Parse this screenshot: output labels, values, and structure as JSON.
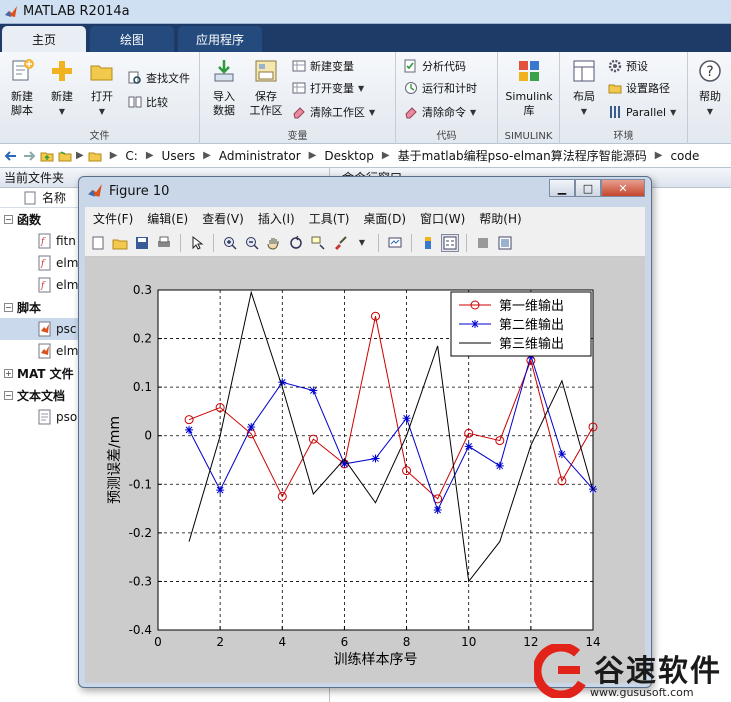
{
  "window": {
    "title": "MATLAB R2014a"
  },
  "tabs": [
    {
      "label": "主页"
    },
    {
      "label": "绘图"
    },
    {
      "label": "应用程序"
    }
  ],
  "ribbon": {
    "file": {
      "label": "文件",
      "new_script": "新建\n脚本",
      "new": "新建",
      "open": "打开",
      "find_files": "查找文件",
      "compare": "比较"
    },
    "variable": {
      "label": "变量",
      "import_data": "导入\n数据",
      "save_workspace": "保存\n工作区",
      "new_variable": "新建变量",
      "open_variable": "打开变量",
      "clear_workspace": "清除工作区"
    },
    "code": {
      "label": "代码",
      "analyze_code": "分析代码",
      "run_and_time": "运行和计时",
      "clear_commands": "清除命令"
    },
    "simulink": {
      "label": "SIMULINK",
      "library": "Simulink\n库"
    },
    "environment": {
      "label": "环境",
      "layout": "布局",
      "preferences": "预设",
      "set_path": "设置路径",
      "parallel": "Parallel"
    },
    "help": {
      "label": "帮助"
    }
  },
  "address": {
    "crumbs": [
      "C:",
      "Users",
      "Administrator",
      "Desktop",
      "基于matlab编程pso-elman算法程序智能源码",
      "code"
    ]
  },
  "current_folder": {
    "header": "当前文件夹",
    "name_column": "名称",
    "tree": [
      {
        "type": "cat",
        "label": "函数",
        "expander": "−"
      },
      {
        "type": "file",
        "label": "fitn",
        "icon": "function-file-icon"
      },
      {
        "type": "file",
        "label": "elm",
        "icon": "function-file-icon"
      },
      {
        "type": "file",
        "label": "elm",
        "icon": "function-file-icon"
      },
      {
        "type": "cat",
        "label": "脚本",
        "expander": "−"
      },
      {
        "type": "file",
        "label": "psc",
        "icon": "script-file-icon",
        "selected": true
      },
      {
        "type": "file",
        "label": "elm",
        "icon": "script-file-icon"
      },
      {
        "type": "cat",
        "label": "MAT 文件",
        "expander": "+"
      },
      {
        "type": "cat",
        "label": "文本文档",
        "expander": "−"
      },
      {
        "type": "file",
        "label": "pso",
        "icon": "text-file-icon"
      }
    ]
  },
  "command_window": {
    "header": "命令行窗口"
  },
  "figure": {
    "title": "Figure 10",
    "menus": [
      "文件(F)",
      "编辑(E)",
      "查看(V)",
      "插入(I)",
      "工具(T)",
      "桌面(D)",
      "窗口(W)",
      "帮助(H)"
    ]
  },
  "chart_data": {
    "type": "line",
    "title": "",
    "xlabel": "训练样本序号",
    "ylabel": "预测误差/mm",
    "xlim": [
      0,
      14
    ],
    "ylim": [
      -0.4,
      0.3
    ],
    "xticks": [
      0,
      2,
      4,
      6,
      8,
      10,
      12,
      14
    ],
    "yticks": [
      -0.4,
      -0.3,
      -0.2,
      -0.1,
      0,
      0.1,
      0.2,
      0.3
    ],
    "grid": true,
    "legend_position": "top-right",
    "x": [
      1,
      2,
      3,
      4,
      5,
      6,
      7,
      8,
      9,
      10,
      11,
      12,
      13,
      14
    ],
    "series": [
      {
        "name": "第一维输出",
        "color": "#cc0000",
        "marker": "circle",
        "values": [
          0.033,
          0.058,
          0.004,
          -0.125,
          -0.007,
          -0.058,
          0.246,
          -0.072,
          -0.13,
          0.005,
          -0.01,
          0.155,
          -0.093,
          0.018
        ]
      },
      {
        "name": "第二维输出",
        "color": "#0000cc",
        "marker": "star",
        "values": [
          0.012,
          -0.112,
          0.018,
          0.11,
          0.093,
          -0.058,
          -0.047,
          0.036,
          -0.153,
          -0.022,
          -0.062,
          0.165,
          -0.038,
          -0.11
        ]
      },
      {
        "name": "第三维输出",
        "color": "#000000",
        "marker": "none",
        "values": [
          -0.218,
          0.0,
          0.295,
          0.1,
          -0.12,
          -0.048,
          -0.138,
          0.0,
          0.185,
          -0.3,
          -0.218,
          -0.02,
          0.113,
          -0.113
        ]
      }
    ]
  },
  "watermark": {
    "brand": "谷速软件",
    "url": "www.gususoft.com"
  }
}
